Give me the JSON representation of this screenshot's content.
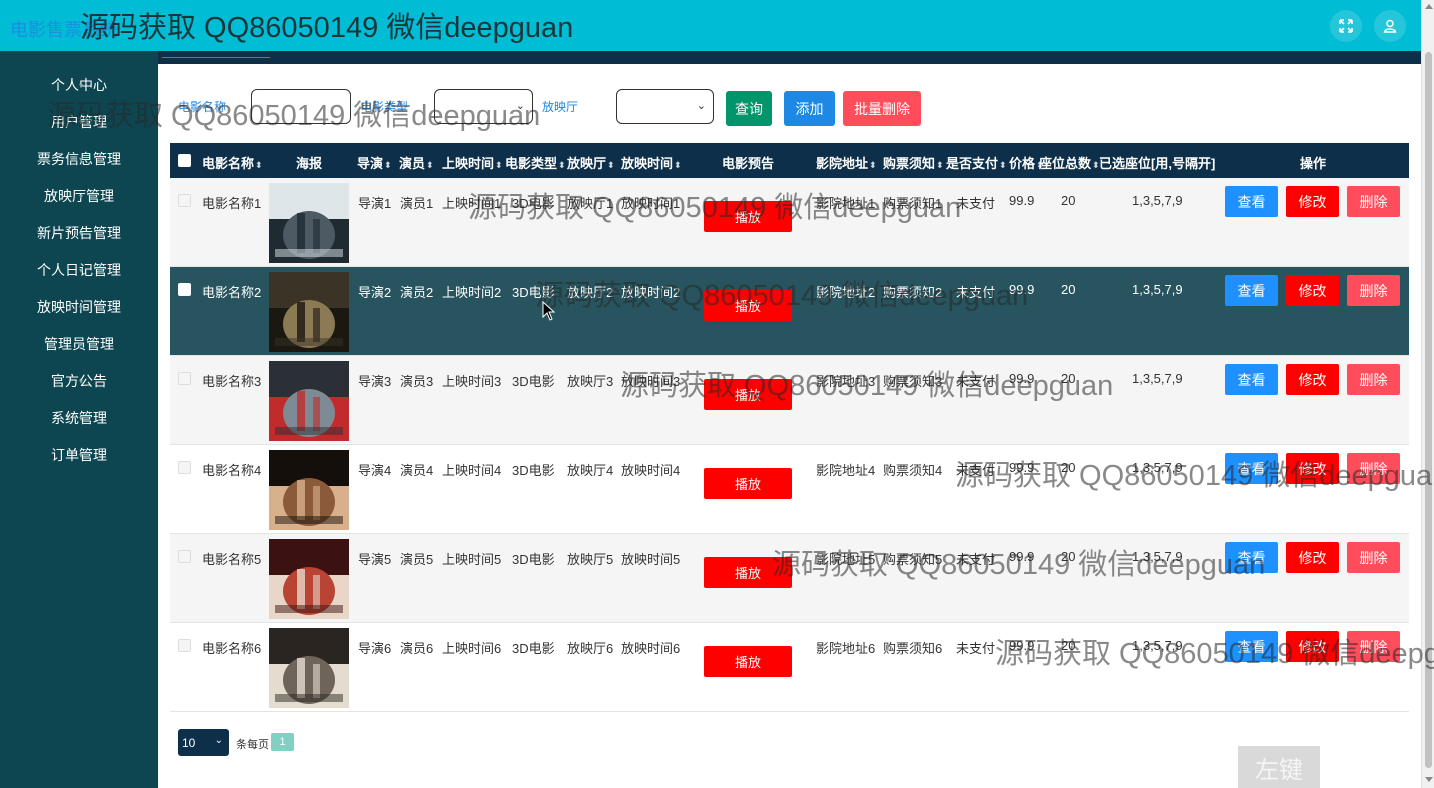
{
  "header": {
    "app_title": "电影售票系统",
    "icons": [
      "fullscreen-icon",
      "user-icon"
    ]
  },
  "sidebar": {
    "items": [
      {
        "label": "个人中心"
      },
      {
        "label": "用户管理"
      },
      {
        "label": "票务信息管理"
      },
      {
        "label": "放映厅管理"
      },
      {
        "label": "新片预告管理"
      },
      {
        "label": "个人日记管理"
      },
      {
        "label": "放映时间管理"
      },
      {
        "label": "管理员管理"
      },
      {
        "label": "官方公告"
      },
      {
        "label": "系统管理"
      },
      {
        "label": "订单管理"
      }
    ]
  },
  "search": {
    "movie_name_label": "电影名称",
    "movie_name_value": "",
    "movie_type_label": "电影类型",
    "movie_type_value": "",
    "hall_label": "放映厅",
    "hall_value": "",
    "query_button": "查询",
    "add_button": "添加",
    "batch_delete_button": "批量删除"
  },
  "colors": {
    "query": "#00956b",
    "add": "#1e88e5",
    "batch_delete": "#ff4d5b",
    "view": "#1e90ff",
    "edit": "#ff0000",
    "delete": "#ff4d5b",
    "play": "#ff0000",
    "header_bg": "#00bcd4",
    "sidebar_bg": "#0d4650",
    "table_head_bg": "#0d2f4a"
  },
  "table": {
    "headers": [
      "电影名称",
      "海报",
      "导演",
      "演员",
      "上映时间",
      "电影类型",
      "放映厅",
      "放映时间",
      "电影预告",
      "影院地址",
      "购票须知",
      "是否支付",
      "价格",
      "座位总数",
      "已选座位[用,号隔开]",
      "操作"
    ],
    "play_label": "播放",
    "view_label": "查看",
    "edit_label": "修改",
    "delete_label": "删除",
    "rows": [
      {
        "name": "电影名称1",
        "director": "导演1",
        "actor": "演员1",
        "release": "上映时间1",
        "type": "3D电影",
        "hall": "放映厅1",
        "time": "放映时间1",
        "address": "影院地址1",
        "notice": "购票须知1",
        "paid": "未支付",
        "price": "99.9",
        "seats": "20",
        "selected": "1,3,5,7,9",
        "poster": "poster-chronicle"
      },
      {
        "name": "电影名称2",
        "director": "导演2",
        "actor": "演员2",
        "release": "上映时间2",
        "type": "3D电影",
        "hall": "放映厅2",
        "time": "放映时间2",
        "address": "影院地址2",
        "notice": "购票须知2",
        "paid": "未支付",
        "price": "99.9",
        "seats": "20",
        "selected": "1,3,5,7,9",
        "poster": "poster-act-of-valor"
      },
      {
        "name": "电影名称3",
        "director": "导演3",
        "actor": "演员3",
        "release": "上映时间3",
        "type": "3D电影",
        "hall": "放映厅3",
        "time": "放映时间3",
        "address": "影院地址3",
        "notice": "购票须知3",
        "paid": "未支付",
        "price": "99.9",
        "seats": "20",
        "selected": "1,3,5,7,9",
        "poster": "poster-action"
      },
      {
        "name": "电影名称4",
        "director": "导演4",
        "actor": "演员4",
        "release": "上映时间4",
        "type": "3D电影",
        "hall": "放映厅4",
        "time": "放映时间4",
        "address": "影院地址4",
        "notice": "购票须知4",
        "paid": "未支付",
        "price": "99.9",
        "seats": "20",
        "selected": "1,3,5,7,9",
        "poster": "poster-fighter"
      },
      {
        "name": "电影名称5",
        "director": "导演5",
        "actor": "演员5",
        "release": "上映时间5",
        "type": "3D电影",
        "hall": "放映厅5",
        "time": "放映时间5",
        "address": "影院地址5",
        "notice": "购票须知5",
        "paid": "未支付",
        "price": "99.9",
        "seats": "20",
        "selected": "1,3,5,7,9",
        "poster": "poster-war"
      },
      {
        "name": "电影名称6",
        "director": "导演6",
        "actor": "演员6",
        "release": "上映时间6",
        "type": "3D电影",
        "hall": "放映厅6",
        "time": "放映时间6",
        "address": "影院地址6",
        "notice": "购票须知6",
        "paid": "未支付",
        "price": "99.9",
        "seats": "20",
        "selected": "1,3,5,7,9",
        "poster": "poster-jizhan"
      }
    ]
  },
  "pager": {
    "page_size": "10",
    "per_page_label": "条每页",
    "current_page": "1"
  },
  "key_hint": "左键",
  "watermark": "源码获取 QQ86050149 微信deepguan"
}
